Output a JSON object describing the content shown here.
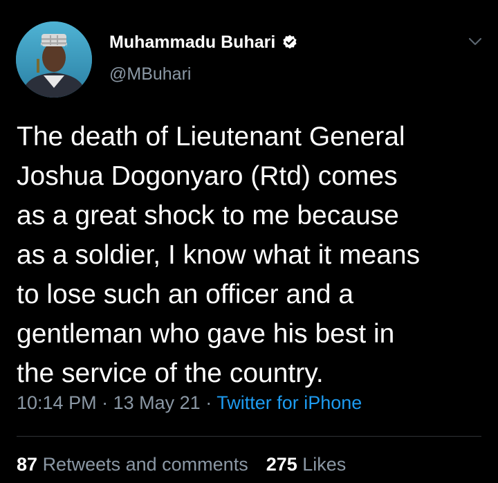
{
  "tweet": {
    "author": {
      "display_name": "Muhammadu Buhari",
      "handle": "@MBuhari",
      "verified_icon": "verified-badge-icon",
      "avatar_icon": "profile-photo"
    },
    "menu_icon": "chevron-down-icon",
    "text": "The death of Lieutenant General\nJoshua Dogonyaro (Rtd) comes\nas a great shock to me because\nas a soldier, I know what it means\nto lose such an officer and a\ngentleman who gave his best in\nthe service of the country.",
    "time": "10:14 PM",
    "date": "13 May 21",
    "separator": "·",
    "source": "Twitter for iPhone",
    "stats": {
      "retweets_count": "87",
      "retweets_label": "Retweets and comments",
      "likes_count": "275",
      "likes_label": "Likes"
    }
  },
  "colors": {
    "background": "#000000",
    "primary_text": "#ffffff",
    "secondary_text": "#8b98a5",
    "accent": "#1d9bf0",
    "divider": "#2f3336"
  }
}
